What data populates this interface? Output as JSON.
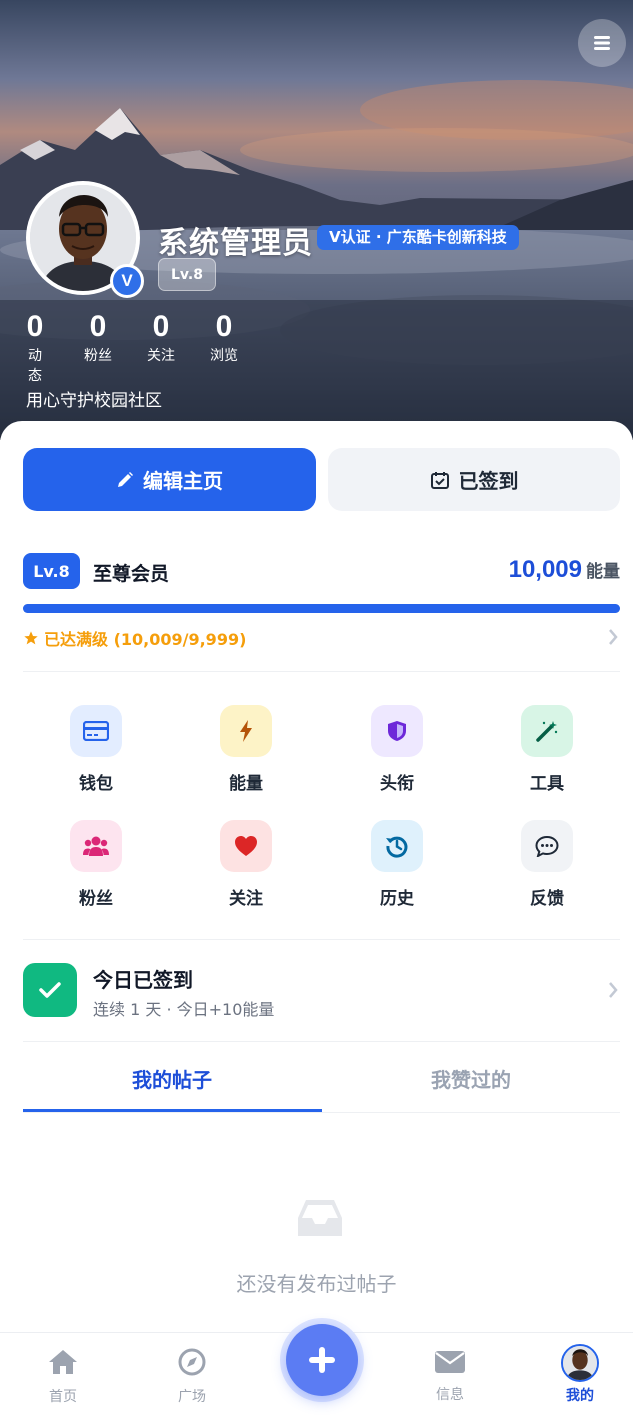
{
  "profile": {
    "name": "系统管理员",
    "verification": "V认证 · 广东酷卡创新科技",
    "level_pill": "Lv.8",
    "verified_mark": "V",
    "bio": "用心守护校园社区",
    "stats": [
      {
        "value": "0",
        "label": "动态"
      },
      {
        "value": "0",
        "label": "粉丝"
      },
      {
        "value": "0",
        "label": "关注"
      },
      {
        "value": "0",
        "label": "浏览"
      }
    ]
  },
  "actions": {
    "edit_label": "编辑主页",
    "signin_label": "已签到"
  },
  "membership": {
    "level": "Lv.8",
    "title": "至尊会员",
    "energy_value": "10,009",
    "energy_unit": "能量",
    "progress_fraction": 1.0,
    "status_text": "已达满级 (10,009/9,999)"
  },
  "grid": [
    {
      "label": "钱包",
      "icon": "wallet-icon",
      "bg": "#e3edff",
      "fg": "#2563eb"
    },
    {
      "label": "能量",
      "icon": "bolt-icon",
      "bg": "#fdf3c7",
      "fg": "#d97706"
    },
    {
      "label": "头衔",
      "icon": "shield-icon",
      "bg": "#eee8ff",
      "fg": "#7c3aed"
    },
    {
      "label": "工具",
      "icon": "magic-wand-icon",
      "bg": "#d8f5e6",
      "fg": "#059669"
    },
    {
      "label": "粉丝",
      "icon": "users-icon",
      "bg": "#fde4ef",
      "fg": "#db2777"
    },
    {
      "label": "关注",
      "icon": "heart-icon",
      "bg": "#fde2e2",
      "fg": "#dc2626"
    },
    {
      "label": "历史",
      "icon": "history-icon",
      "bg": "#dff1fc",
      "fg": "#0284c7"
    },
    {
      "label": "反馈",
      "icon": "chat-icon",
      "bg": "#f1f3f6",
      "fg": "#374151"
    }
  ],
  "checkin": {
    "title": "今日已签到",
    "subtitle": "连续 1 天 · 今日+10能量"
  },
  "tabs": [
    {
      "label": "我的帖子",
      "active": true
    },
    {
      "label": "我赞过的",
      "active": false
    }
  ],
  "empty_state": "还没有发布过帖子",
  "nav": [
    {
      "label": "首页",
      "icon": "home-icon"
    },
    {
      "label": "广场",
      "icon": "compass-icon"
    },
    {
      "label": "信息",
      "icon": "mail-icon"
    },
    {
      "label": "我的",
      "icon": "avatar"
    }
  ],
  "colors": {
    "primary": "#2563eb",
    "success": "#10b981",
    "warning": "#f59e0b"
  }
}
